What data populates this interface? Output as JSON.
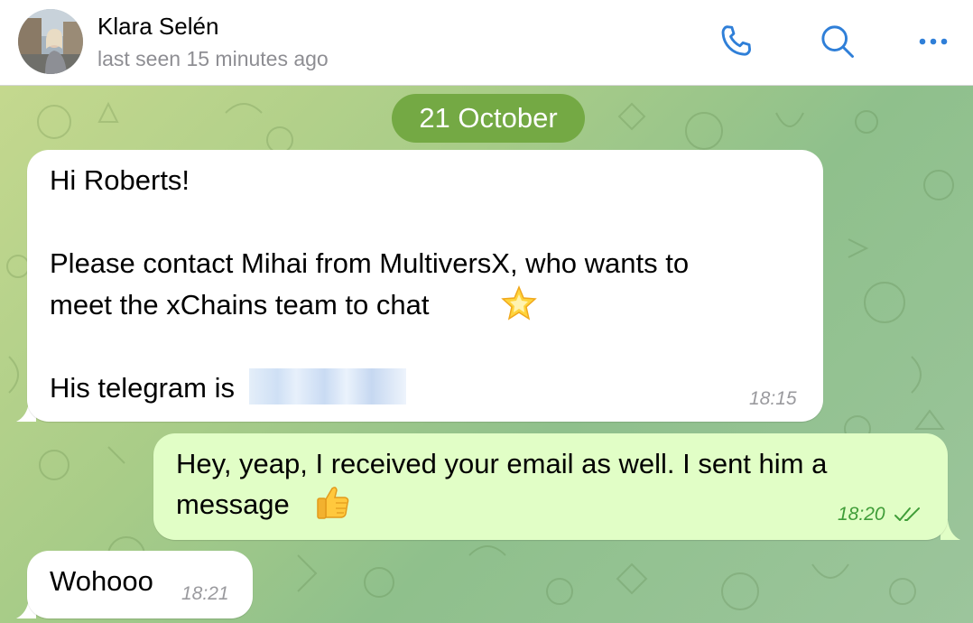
{
  "header": {
    "contact_name": "Klara Selén",
    "status": "last seen 15 minutes ago",
    "icons": [
      "phone-icon",
      "search-icon",
      "more-icon"
    ]
  },
  "chat": {
    "date_label": "21 October",
    "messages": [
      {
        "direction": "incoming",
        "lines": [
          "Hi Roberts!",
          "Please contact Mihai from MultiversX, who wants to",
          "meet the xChains team to chat",
          "His telegram is"
        ],
        "emoji": "star-emoji",
        "time": "18:15"
      },
      {
        "direction": "outgoing",
        "lines": [
          "Hey, yeap, I received your email as well. I sent him a",
          "message"
        ],
        "emoji": "thumbs-up-emoji",
        "time": "18:20",
        "status": "read"
      },
      {
        "direction": "incoming",
        "lines": [
          "Wohooo"
        ],
        "time": "18:21"
      }
    ]
  },
  "colors": {
    "accent": "#2f7fd8",
    "date_pill": "#74a944",
    "outgoing_bubble": "#e1fec6",
    "outgoing_time": "#3f9d38",
    "incoming_bubble": "#ffffff"
  }
}
